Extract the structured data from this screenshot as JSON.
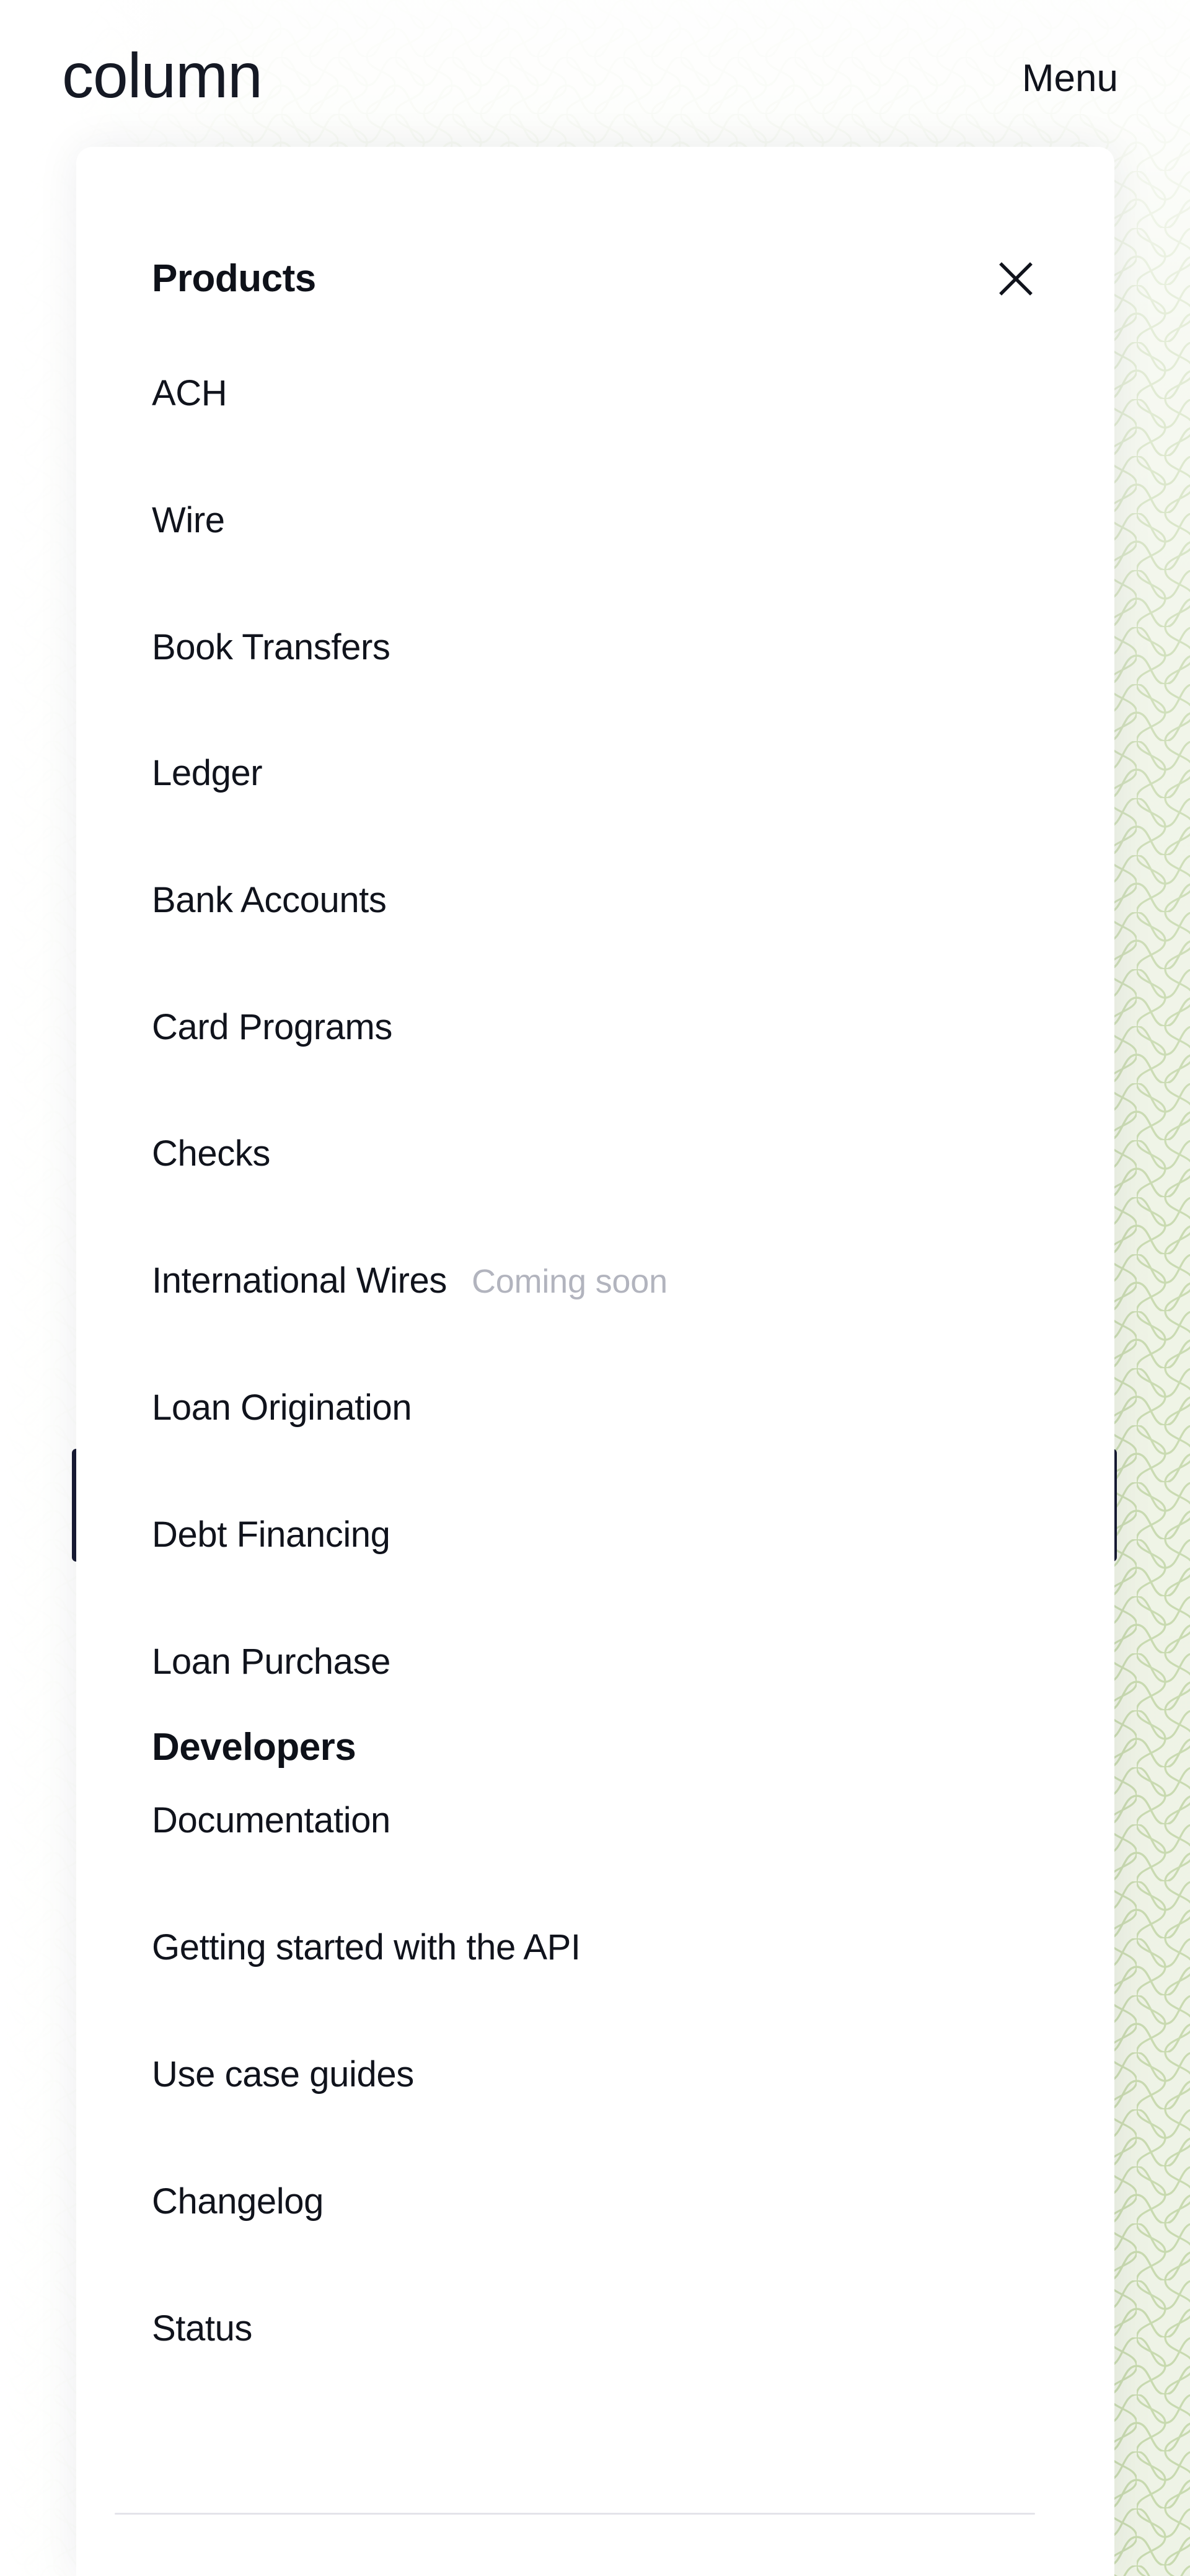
{
  "header": {
    "brand": "column",
    "menu_label": "Menu"
  },
  "menu_panel": {
    "close_icon": "close-icon",
    "sections": [
      {
        "id": "products",
        "title": "Products",
        "items": [
          {
            "label": "ACH",
            "tag": ""
          },
          {
            "label": "Wire",
            "tag": ""
          },
          {
            "label": "Book Transfers",
            "tag": ""
          },
          {
            "label": "Ledger",
            "tag": ""
          },
          {
            "label": "Bank Accounts",
            "tag": ""
          },
          {
            "label": "Card Programs",
            "tag": ""
          },
          {
            "label": "Checks",
            "tag": ""
          },
          {
            "label": "International Wires",
            "tag": "Coming soon"
          },
          {
            "label": "Loan Origination",
            "tag": ""
          },
          {
            "label": "Debt Financing",
            "tag": ""
          },
          {
            "label": "Loan Purchase",
            "tag": ""
          }
        ]
      },
      {
        "id": "developers",
        "title": "Developers",
        "items": [
          {
            "label": "Documentation",
            "tag": ""
          },
          {
            "label": "Getting started with the API",
            "tag": ""
          },
          {
            "label": "Use case guides",
            "tag": ""
          },
          {
            "label": "Changelog",
            "tag": ""
          },
          {
            "label": "Status",
            "tag": ""
          }
        ]
      }
    ]
  },
  "theme": {
    "pattern_background": "#eef3e5",
    "pattern_line": "#c7d9ae",
    "text_primary": "#10131c",
    "text_muted": "#b2b4be",
    "sheet_background": "#ffffff",
    "divider": "#e3e3ea",
    "hidden_bar": "#171a33"
  }
}
